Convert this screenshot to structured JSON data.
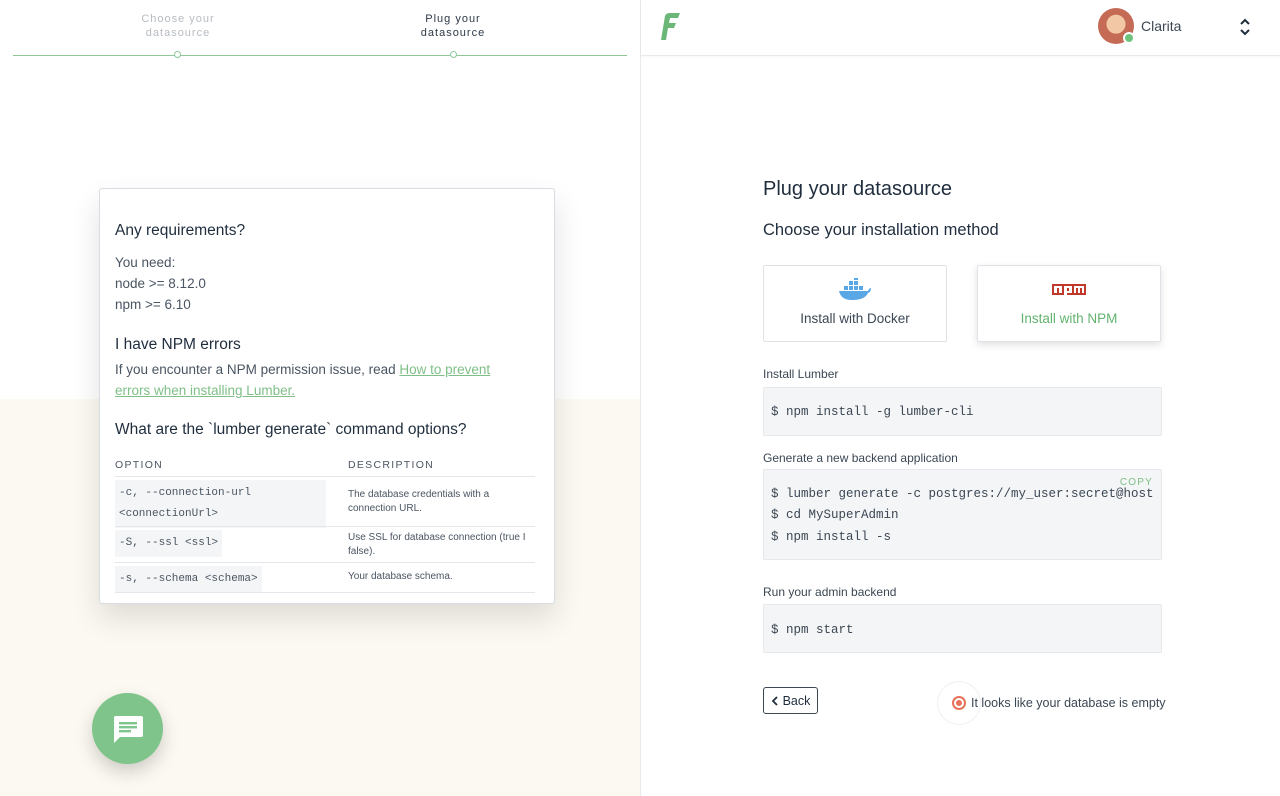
{
  "stepper": {
    "steps": [
      {
        "line1": "Choose your",
        "line2": "datasource"
      },
      {
        "line1": "Plug your",
        "line2": "datasource"
      }
    ]
  },
  "help_card": {
    "req_title": "Any requirements?",
    "req_lines": [
      "You need:",
      "node >= 8.12.0",
      "npm >= 6.10"
    ],
    "npm_title": "I have NPM errors",
    "npm_text": "If you encounter a NPM permission issue, read ",
    "npm_link_1": "How to prevent",
    "npm_link_2": "errors when installing Lumber.",
    "cmd_title": "What are the `lumber generate` command options?",
    "table": {
      "headers": [
        "OPTION",
        "DESCRIPTION"
      ],
      "rows": [
        {
          "option_1": "-c, --connection-url",
          "option_2": "<connectionUrl>",
          "desc_1": "The database credentials with a",
          "desc_2": "connection URL."
        },
        {
          "option_1": "-S, --ssl <ssl>",
          "option_2": "",
          "desc_1": "Use SSL for database connection (true I",
          "desc_2": "false)."
        },
        {
          "option_1": "-s, --schema <schema>",
          "option_2": "",
          "desc_1": "Your database schema.",
          "desc_2": ""
        }
      ]
    }
  },
  "topbar": {
    "user_name": "Clarita"
  },
  "main": {
    "title": "Plug your datasource",
    "subtitle": "Choose your installation method",
    "methods": [
      {
        "label": "Install with Docker",
        "icon": "docker-icon"
      },
      {
        "label": "Install with NPM",
        "icon": "npm-icon",
        "selected": true
      }
    ],
    "install_label": "Install Lumber",
    "install_cmd": "$ npm install -g lumber-cli",
    "generate_label": "Generate a new backend application",
    "copy_label": "COPY",
    "generate_cmds": [
      "$ lumber generate -c postgres://my_user:secret@host",
      "$ cd MySuperAdmin",
      "$ npm install -s"
    ],
    "run_label": "Run your admin backend",
    "run_cmd": "$ npm start",
    "back_label": "Back",
    "status_text": "It looks like your database is empty"
  },
  "colors": {
    "accent": "#7fbf87",
    "npm_red": "#c0392b",
    "docker_blue": "#5aa7e6",
    "status_orange": "#e6735a"
  }
}
